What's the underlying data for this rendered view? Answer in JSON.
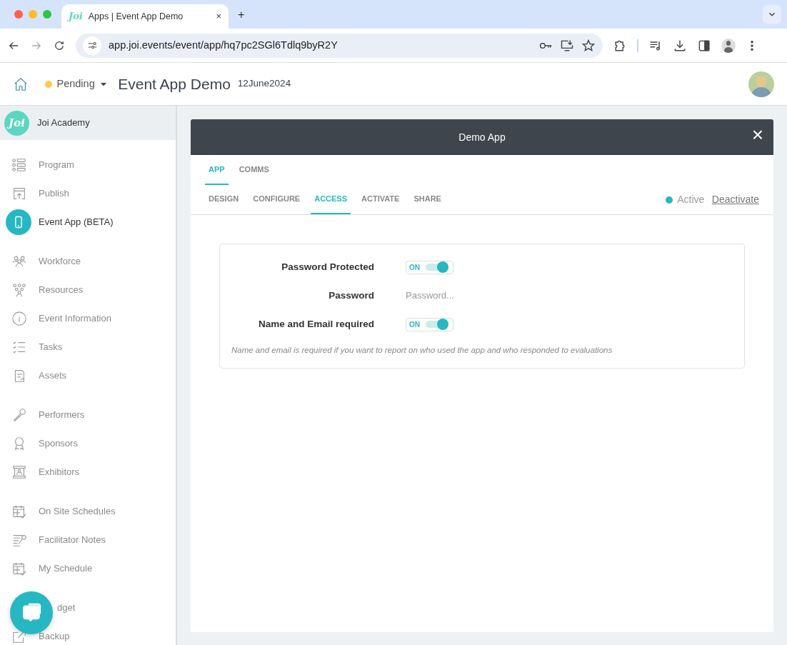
{
  "browser": {
    "tab": {
      "logo": "Joi",
      "title": "Apps | Event App Demo",
      "close": "×"
    },
    "new_tab": "+",
    "url": "app.joi.events/event/app/hq7pc2SGl6Tdlq9byR2Y"
  },
  "header": {
    "status": {
      "label": "Pending",
      "color": "#ffc94d"
    },
    "title": "Event App Demo",
    "date": "12June2024"
  },
  "sidebar": {
    "org": {
      "logo": "Joi",
      "name": "Joi Academy"
    },
    "groups": [
      {
        "items": [
          {
            "label": "Program",
            "kind": "program",
            "selected": false
          },
          {
            "label": "Publish",
            "kind": "publish",
            "selected": false
          },
          {
            "label": "Event App (BETA)",
            "kind": "phone",
            "selected": true
          }
        ]
      },
      {
        "items": [
          {
            "label": "Workforce",
            "kind": "people",
            "selected": false
          },
          {
            "label": "Resources",
            "kind": "group",
            "selected": false
          },
          {
            "label": "Event Information",
            "kind": "info",
            "selected": false
          },
          {
            "label": "Tasks",
            "kind": "tasks",
            "selected": false
          },
          {
            "label": "Assets",
            "kind": "document",
            "selected": false
          }
        ]
      },
      {
        "items": [
          {
            "label": "Performers",
            "kind": "microphone",
            "selected": false
          },
          {
            "label": "Sponsors",
            "kind": "award",
            "selected": false
          },
          {
            "label": "Exhibitors",
            "kind": "booth",
            "selected": false
          }
        ]
      },
      {
        "items": [
          {
            "label": "On Site Schedules",
            "kind": "calendar",
            "selected": false
          },
          {
            "label": "Facilitator Notes",
            "kind": "notes",
            "selected": false
          },
          {
            "label": "My Schedule",
            "kind": "calendar",
            "selected": false
          }
        ]
      },
      {
        "items": [
          {
            "label": "dget",
            "kind": "covered",
            "selected": false
          },
          {
            "label": "Backup",
            "kind": "external",
            "selected": false
          }
        ]
      }
    ]
  },
  "modal": {
    "title": "Demo App",
    "close": "×",
    "tabs": [
      {
        "label": "APP",
        "selected": true
      },
      {
        "label": "COMMS",
        "selected": false
      }
    ],
    "subtabs": [
      {
        "label": "DESIGN",
        "selected": false
      },
      {
        "label": "CONFIGURE",
        "selected": false
      },
      {
        "label": "ACCESS",
        "selected": true
      },
      {
        "label": "ACTIVATE",
        "selected": false
      },
      {
        "label": "SHARE",
        "selected": false
      }
    ],
    "status": {
      "label": "Active",
      "color": "#26b8c2"
    },
    "action": "Deactivate",
    "form": {
      "rows": [
        {
          "kind": "toggle",
          "label": "Password Protected",
          "on": true,
          "text": "ON"
        },
        {
          "kind": "input",
          "label": "Password",
          "placeholder": "Password..."
        },
        {
          "kind": "toggle",
          "label": "Name and Email required",
          "on": true,
          "text": "ON"
        }
      ],
      "note": "Name and email is required if you want to report on who used the app and who responded to evaluations"
    }
  }
}
